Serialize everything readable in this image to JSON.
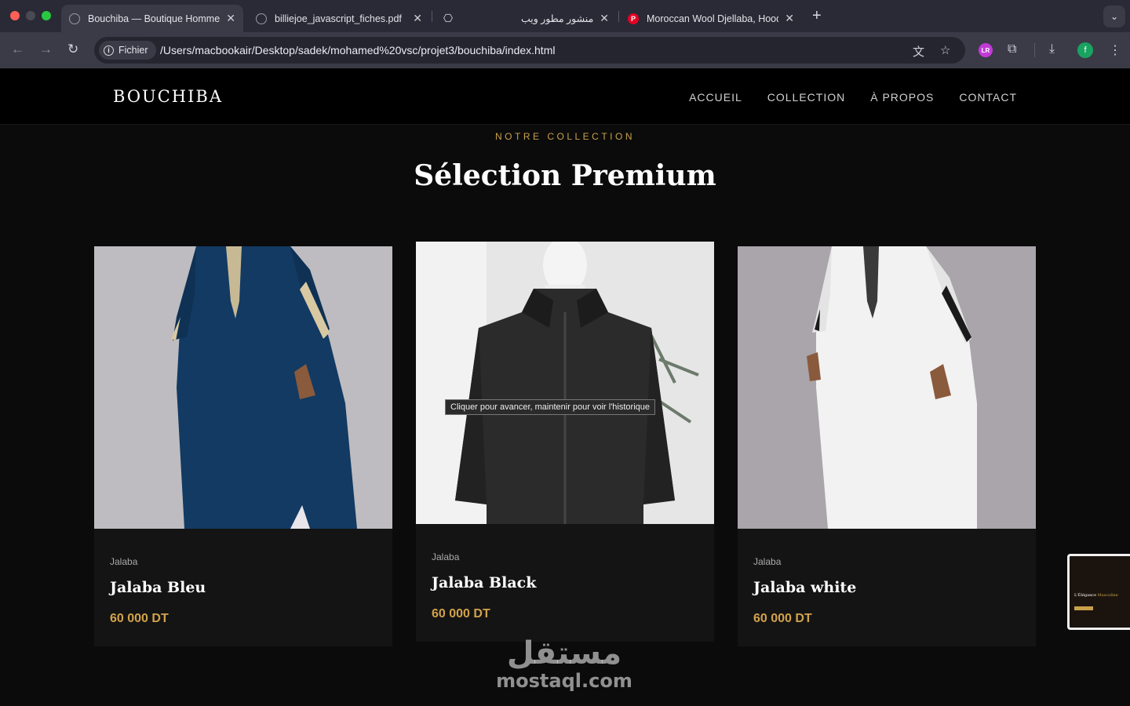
{
  "browser": {
    "tabs": [
      {
        "title": "Bouchiba — Boutique Homme",
        "icon": "globe-icon",
        "active": true
      },
      {
        "title": "billiejoe_javascript_fiches.pdf",
        "icon": "globe-icon",
        "active": false
      },
      {
        "title": "",
        "icon": "openai-icon",
        "active": false
      },
      {
        "title": "منشور مطور ويب",
        "icon": "",
        "active": false
      },
      {
        "title": "Moroccan Wool Djellaba, Hooded",
        "icon": "pinterest-icon",
        "active": false
      }
    ],
    "address_chip": "Fichier",
    "url": "/Users/macbookair/Desktop/sadek/mohamed%20vsc/projet3/bouchiba/index.html",
    "profile_initial": "f",
    "ext_badge": "LR"
  },
  "site": {
    "logo": "BOUCHIBA",
    "nav": [
      "ACCUEIL",
      "COLLECTION",
      "À PROPOS",
      "CONTACT"
    ],
    "eyebrow": "NOTRE COLLECTION",
    "title": "Sélection Premium",
    "accent_color": "#c8a04a",
    "products": [
      {
        "category": "Jalaba",
        "name": "Jalaba Bleu",
        "price": "60 000 DT"
      },
      {
        "category": "Jalaba",
        "name": "Jalaba Black",
        "price": "60 000 DT"
      },
      {
        "category": "Jalaba",
        "name": "Jalaba white",
        "price": "60 000 DT"
      }
    ]
  },
  "tooltip": "Cliquer pour avancer, maintenir pour voir l'historique",
  "thumbnail": {
    "title_a": "L'Élégance",
    "title_b": "Masculine"
  },
  "watermark": {
    "arabic": "مستقل",
    "latin": "mostaql.com"
  }
}
